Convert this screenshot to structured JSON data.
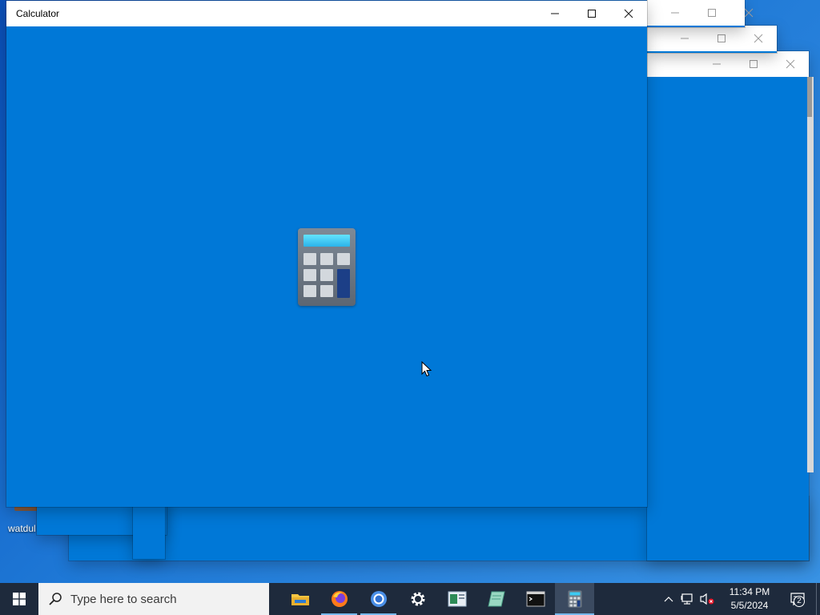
{
  "desktop": {
    "icon_label": "watdul"
  },
  "main_window": {
    "title": "Calculator"
  },
  "taskbar": {
    "search_placeholder": "Type here to search",
    "apps": [
      {
        "name": "File Explorer",
        "icon": "folder-icon"
      },
      {
        "name": "Firefox",
        "icon": "firefox-icon"
      },
      {
        "name": "Chrome",
        "icon": "chrome-icon"
      },
      {
        "name": "Settings",
        "icon": "gear-icon"
      },
      {
        "name": "Document",
        "icon": "document-icon"
      },
      {
        "name": "Notes",
        "icon": "notes-icon"
      },
      {
        "name": "Terminal",
        "icon": "terminal-icon"
      },
      {
        "name": "Calculator",
        "icon": "calculator-icon"
      }
    ],
    "clock_time": "11:34 PM",
    "clock_date": "5/5/2024",
    "notification_count": "2"
  },
  "colors": {
    "app_background": "#0078d7",
    "taskbar": "#1e2a3c",
    "titlebar": "#ffffff"
  }
}
